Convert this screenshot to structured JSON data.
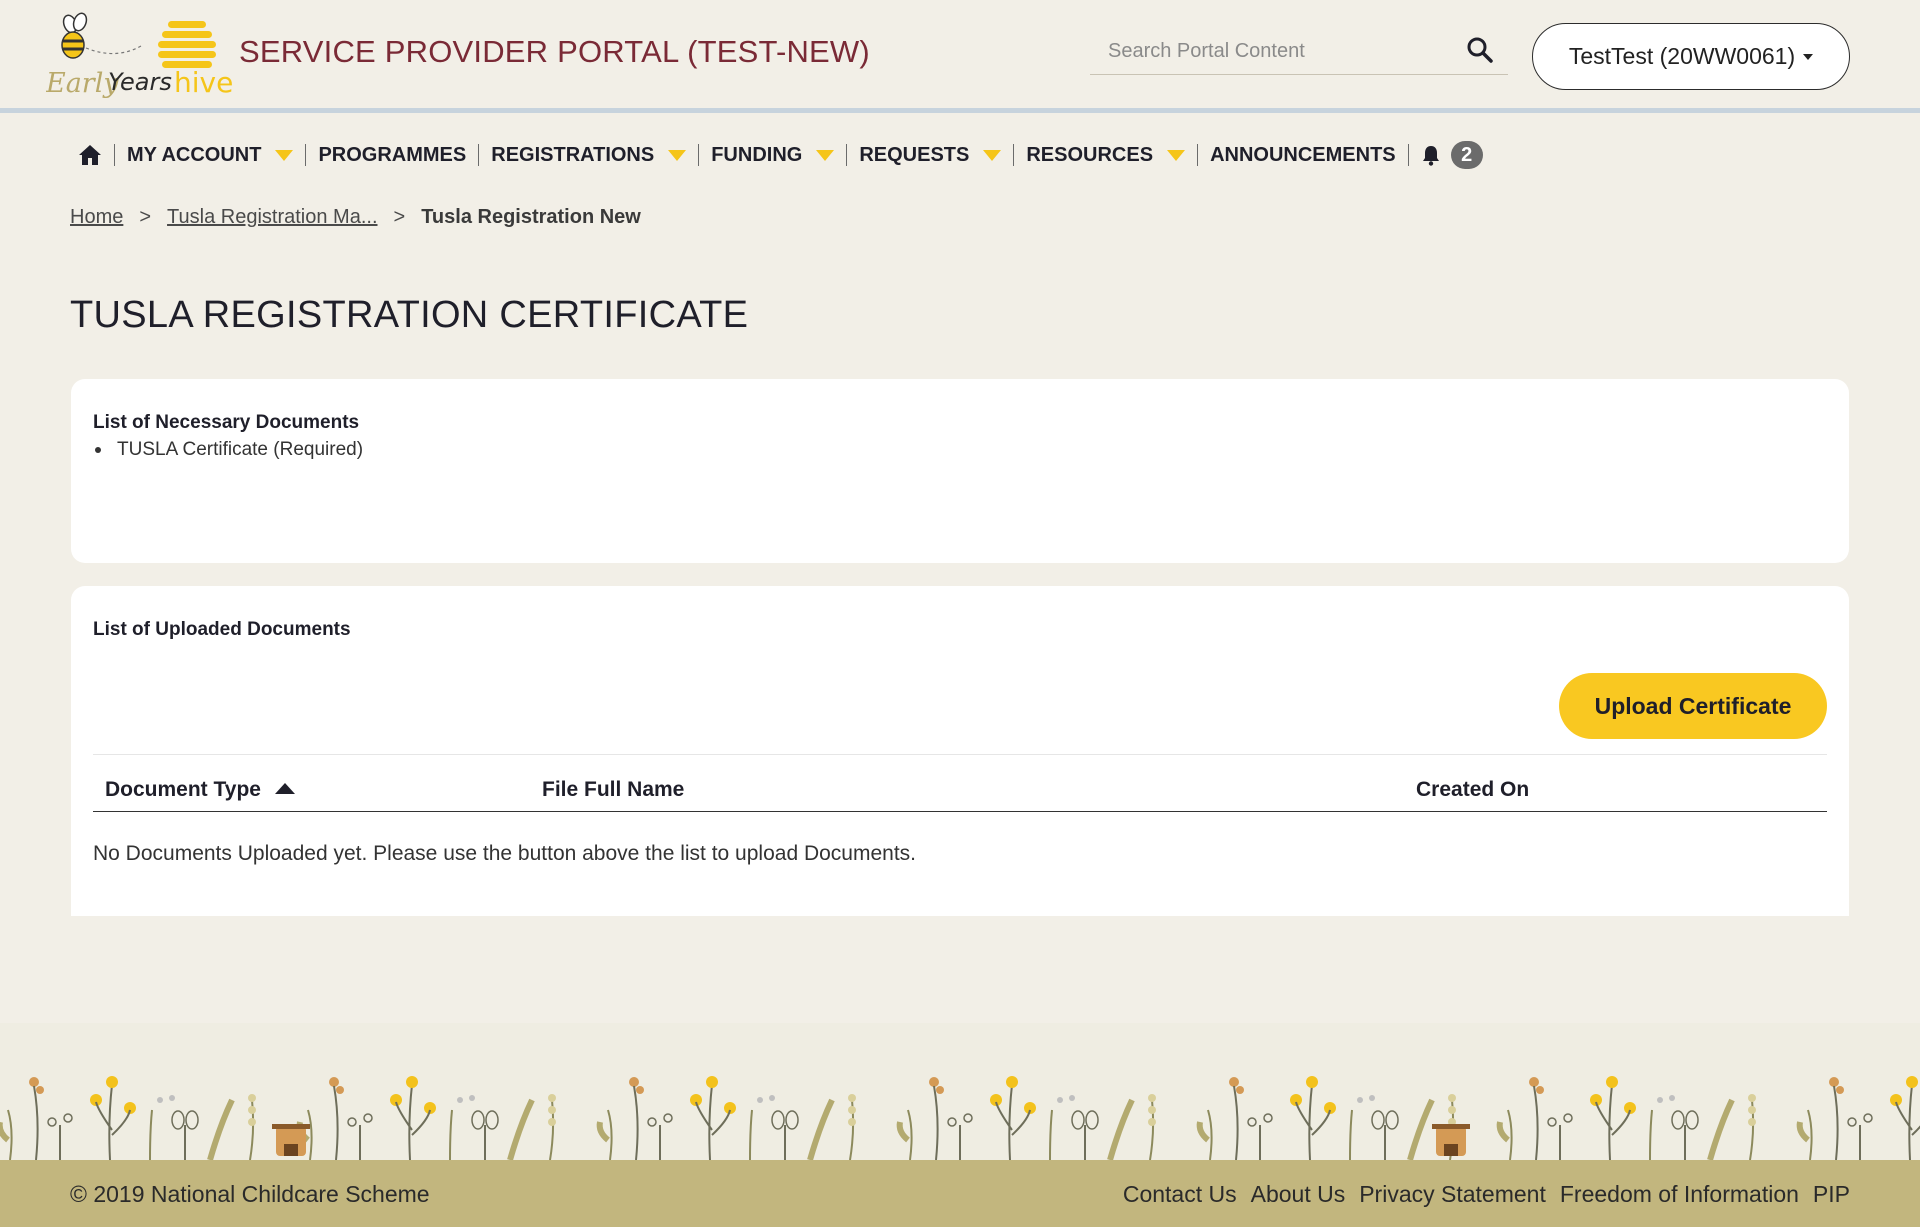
{
  "header": {
    "logo_text_early": "Early",
    "logo_text_years": "Years",
    "logo_text_hive": "hive",
    "portal_title": "SERVICE PROVIDER PORTAL (TEST-NEW)",
    "search_placeholder": "Search Portal Content",
    "user_label": "TestTest (20WW0061)"
  },
  "nav": {
    "items": [
      {
        "label": "MY ACCOUNT",
        "has_dropdown": true
      },
      {
        "label": "PROGRAMMES",
        "has_dropdown": false
      },
      {
        "label": "REGISTRATIONS",
        "has_dropdown": true
      },
      {
        "label": "FUNDING",
        "has_dropdown": true
      },
      {
        "label": "REQUESTS",
        "has_dropdown": true
      },
      {
        "label": "RESOURCES",
        "has_dropdown": true
      },
      {
        "label": "ANNOUNCEMENTS",
        "has_dropdown": false
      }
    ],
    "notification_count": "2"
  },
  "breadcrumb": {
    "home": "Home",
    "parent": "Tusla Registration Ma...",
    "separator": ">",
    "current": "Tusla Registration New"
  },
  "page": {
    "title": "TUSLA REGISTRATION CERTIFICATE"
  },
  "necessary_docs": {
    "heading": "List of Necessary Documents",
    "items": [
      "TUSLA Certificate (Required)"
    ]
  },
  "uploaded_docs": {
    "heading": "List of Uploaded Documents",
    "upload_button": "Upload Certificate",
    "columns": [
      "Document Type",
      "File Full Name",
      "Created On"
    ],
    "empty_message": "No Documents Uploaded yet. Please use the button above the list to upload Documents."
  },
  "footer": {
    "copyright": "© 2019 National Childcare Scheme",
    "links": [
      "Contact Us",
      "About Us",
      "Privacy Statement",
      "Freedom of Information",
      "PIP"
    ]
  },
  "colors": {
    "background": "#f2efe7",
    "title_maroon": "#7a2a36",
    "accent_yellow": "#f9c821",
    "footer_bar": "#c2b67e"
  },
  "icons": [
    "bee-logo-icon",
    "hive-icon",
    "search-icon",
    "home-icon",
    "bell-icon",
    "sort-ascending-icon"
  ]
}
